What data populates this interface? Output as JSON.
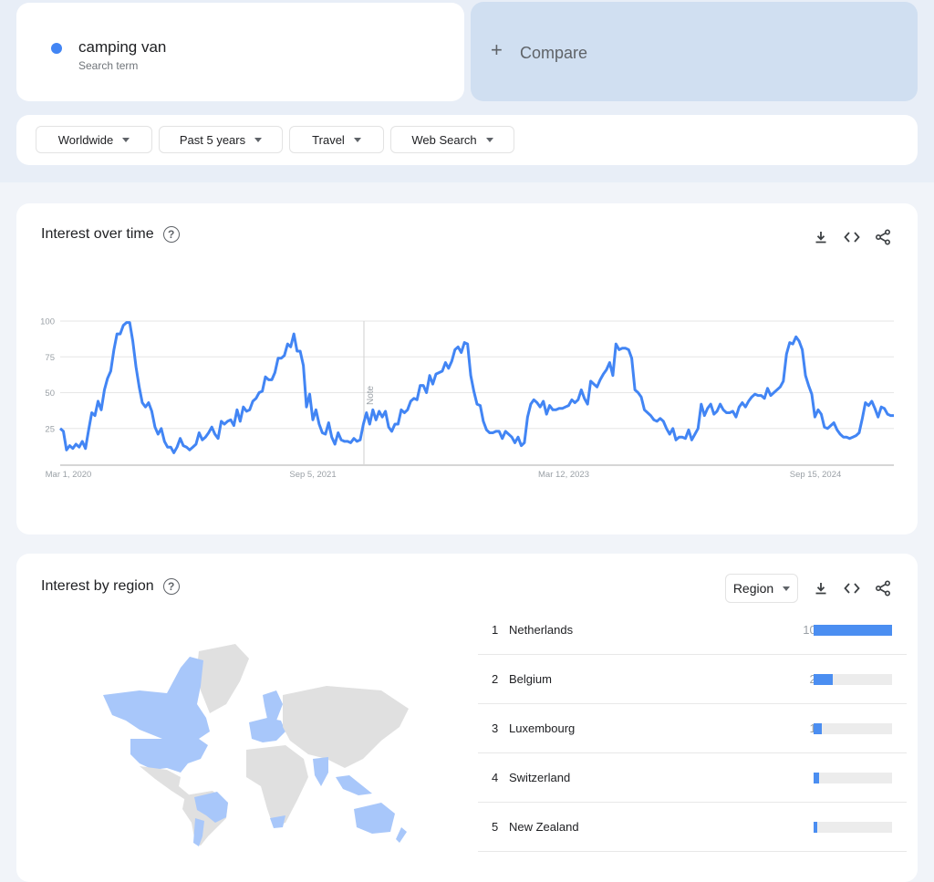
{
  "search": {
    "term": "camping van",
    "term_label": "Search term",
    "term_color": "#4285f4",
    "compare_label": "Compare"
  },
  "filters": [
    {
      "label": "Worldwide"
    },
    {
      "label": "Past 5 years"
    },
    {
      "label": "Travel"
    },
    {
      "label": "Web Search"
    }
  ],
  "interest_over_time": {
    "title": "Interest over time",
    "actions": [
      "download-icon",
      "embed-icon",
      "share-icon"
    ]
  },
  "interest_by_region": {
    "title": "Interest by region",
    "region_select": "Region",
    "map_highlight_color": "#a8c7fa",
    "map_base_color": "#e0e0e0",
    "regions": [
      {
        "rank": "1",
        "name": "Netherlands",
        "value": 100
      },
      {
        "rank": "2",
        "name": "Belgium",
        "value": 24
      },
      {
        "rank": "3",
        "name": "Luxembourg",
        "value": 10
      },
      {
        "rank": "4",
        "name": "Switzerland",
        "value": 7
      },
      {
        "rank": "5",
        "name": "New Zealand",
        "value": 5
      }
    ]
  },
  "chart_data": {
    "type": "line",
    "title": "Interest over time",
    "xlabel": "",
    "ylabel": "",
    "ylim": [
      0,
      100
    ],
    "yticks": [
      25,
      50,
      75,
      100
    ],
    "xtick_labels": [
      "Mar 1, 2020",
      "Sep 5, 2021",
      "Mar 12, 2023",
      "Sep 15, 2024"
    ],
    "x_range": [
      "Mar 1, 2020",
      "Feb 2025"
    ],
    "annotation": "Note",
    "grid": true,
    "series": [
      {
        "name": "camping van",
        "color": "#4285f4",
        "values": [
          25,
          23,
          10,
          13,
          11,
          14,
          12,
          16,
          11,
          24,
          36,
          34,
          44,
          38,
          52,
          60,
          65,
          80,
          91,
          91,
          97,
          99,
          99,
          86,
          68,
          54,
          43,
          40,
          43,
          37,
          26,
          21,
          25,
          16,
          12,
          12,
          8,
          12,
          18,
          13,
          12,
          10,
          12,
          14,
          22,
          17,
          19,
          22,
          26,
          21,
          18,
          30,
          28,
          30,
          31,
          27,
          38,
          30,
          40,
          37,
          38,
          44,
          46,
          50,
          51,
          61,
          59,
          59,
          64,
          74,
          74,
          76,
          84,
          82,
          91,
          79,
          79,
          69,
          40,
          49,
          31,
          38,
          28,
          22,
          21,
          29,
          19,
          14,
          22,
          17,
          16,
          16,
          15,
          18,
          16,
          17,
          28,
          36,
          28,
          38,
          31,
          37,
          33,
          37,
          26,
          23,
          28,
          28,
          38,
          36,
          38,
          44,
          46,
          45,
          55,
          55,
          50,
          62,
          56,
          63,
          64,
          65,
          71,
          67,
          72,
          80,
          82,
          78,
          85,
          84,
          62,
          51,
          42,
          41,
          30,
          24,
          22,
          22,
          23,
          23,
          18,
          23,
          21,
          19,
          15,
          19,
          13,
          15,
          33,
          42,
          45,
          43,
          40,
          44,
          35,
          41,
          38,
          38,
          39,
          39,
          40,
          41,
          45,
          43,
          45,
          52,
          46,
          42,
          58,
          56,
          54,
          59,
          63,
          66,
          71,
          62,
          84,
          80,
          81,
          81,
          80,
          74,
          52,
          50,
          47,
          38,
          36,
          34,
          31,
          30,
          32,
          30,
          25,
          21,
          25,
          17,
          19,
          19,
          18,
          24,
          17,
          21,
          25,
          42,
          34,
          39,
          42,
          35,
          37,
          42,
          38,
          36,
          36,
          37,
          33,
          40,
          43,
          40,
          44,
          47,
          49,
          48,
          48,
          46,
          53,
          48,
          50,
          52,
          54,
          58,
          77,
          85,
          84,
          89,
          86,
          80,
          62,
          55,
          49,
          33,
          38,
          35,
          26,
          25,
          27,
          29,
          24,
          21,
          19,
          19,
          18,
          19,
          20,
          22,
          32,
          43,
          41,
          44,
          39,
          33,
          40,
          39,
          35,
          34,
          34
        ]
      }
    ]
  }
}
